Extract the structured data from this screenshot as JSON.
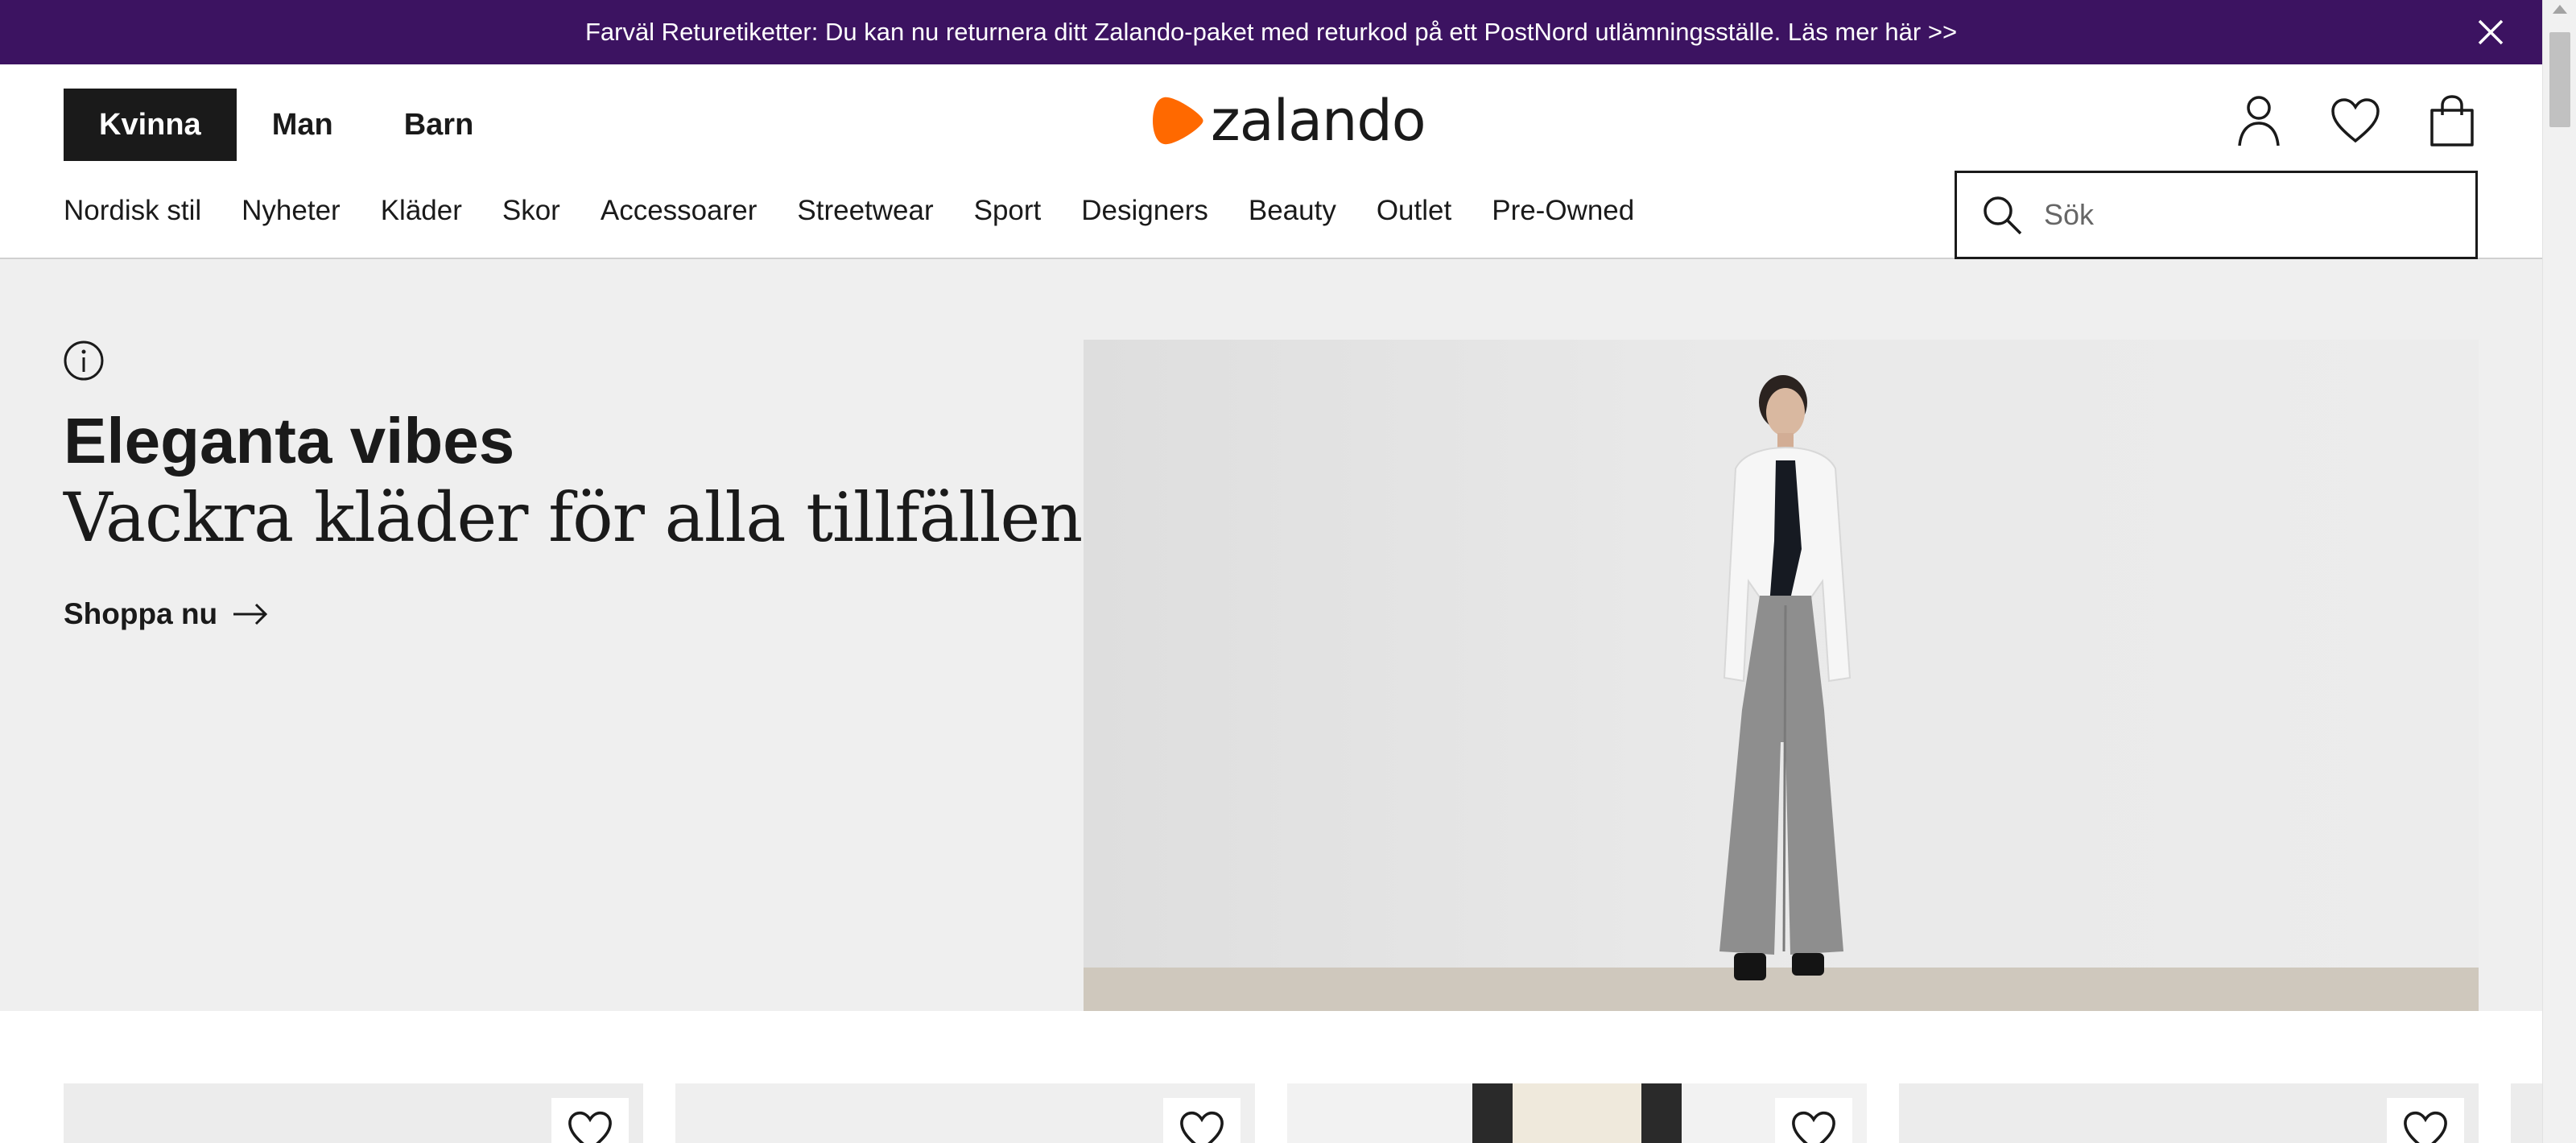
{
  "announcement": {
    "text": "Farväl Returetiketter: Du kan nu returnera ditt Zalando-paket med returkod på ett PostNord utlämningsställe. Läs mer här >>",
    "close_icon": "close-icon",
    "bg_color": "#3c1361"
  },
  "header": {
    "gender_tabs": [
      {
        "label": "Kvinna",
        "active": true
      },
      {
        "label": "Man",
        "active": false
      },
      {
        "label": "Barn",
        "active": false
      }
    ],
    "logo_text": "zalando",
    "logo_color": "#ff6900",
    "icons": [
      "user-icon",
      "heart-icon",
      "shopping-bag-icon"
    ],
    "nav": [
      "Nordisk stil",
      "Nyheter",
      "Kläder",
      "Skor",
      "Accessoarer",
      "Streetwear",
      "Sport",
      "Designers",
      "Beauty",
      "Outlet",
      "Pre-Owned"
    ],
    "search": {
      "placeholder": "Sök",
      "value": ""
    }
  },
  "hero": {
    "title": "Eleganta vibes",
    "subtitle": "Vackra kläder för alla tillfällen",
    "cta": "Shoppa nu",
    "bg_color": "#efefef"
  },
  "products": {
    "count_visible": 5
  }
}
